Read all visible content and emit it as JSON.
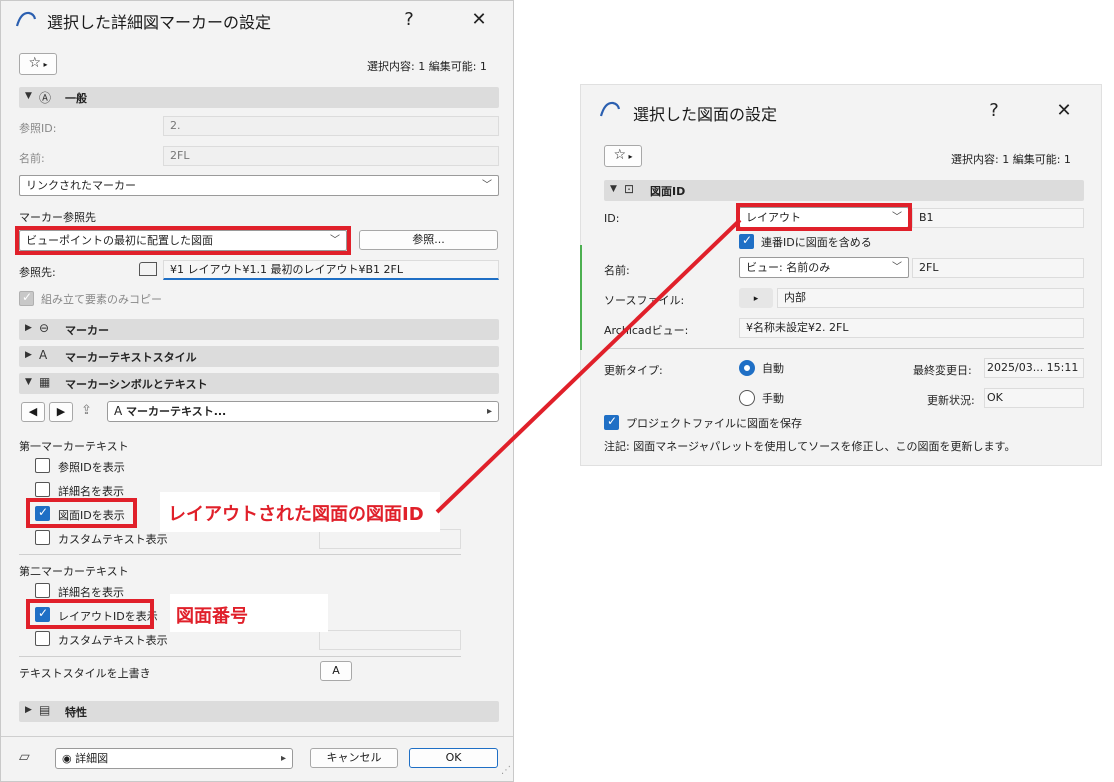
{
  "left": {
    "title": "選択した詳細図マーカーの設定",
    "help": "?",
    "close": "✕",
    "selection_status": "選択内容: 1 編集可能: 1",
    "general": {
      "section_label": "一般",
      "ref_id_label": "参照ID:",
      "ref_id_value": "2.",
      "name_label": "名前:",
      "name_value": "2FL",
      "linked_marker": "リンクされたマーカー",
      "marker_ref_label": "マーカー参照先",
      "marker_ref_value": "ビューポイントの最初に配置した図面",
      "browse_button": "参照...",
      "ref_to_label": "参照先:",
      "ref_to_value": "¥1 レイアウト¥1.1 最初のレイアウト¥B1 2FL",
      "assembly_only": "組み立て要素のみコピー"
    },
    "sections": {
      "marker": "マーカー",
      "marker_text_style": "マーカーテキストスタイル",
      "marker_symbol_text": "マーカーシンボルとテキスト",
      "properties": "特性"
    },
    "marker_text_dropdown": "マーカーテキスト...",
    "first_marker_text": {
      "heading": "第一マーカーテキスト",
      "items": [
        "参照IDを表示",
        "詳細名を表示",
        "図面IDを表示",
        "カスタムテキスト表示"
      ]
    },
    "second_marker_text": {
      "heading": "第二マーカーテキスト",
      "items": [
        "詳細名を表示",
        "レイアウトIDを表示",
        "カスタムテキスト表示"
      ]
    },
    "override_text_style": "テキストスタイルを上書き",
    "footer": {
      "view_select": "詳細図",
      "cancel": "キャンセル",
      "ok": "OK"
    }
  },
  "right": {
    "title": "選択した図面の設定",
    "help": "?",
    "close": "✕",
    "selection_status": "選択内容: 1 編集可能: 1",
    "section_label": "図面ID",
    "id_label": "ID:",
    "id_select": "レイアウト",
    "id_value": "B1",
    "include_serial": "連番IDに図面を含める",
    "name_label": "名前:",
    "name_select": "ビュー: 名前のみ",
    "name_value": "2FL",
    "source_file_label": "ソースファイル:",
    "source_file_value": "内部",
    "archicad_view_label": "Archicadビュー:",
    "archicad_view_value": "¥名称未設定¥2. 2FL",
    "update_type_label": "更新タイプ:",
    "auto": "自動",
    "manual": "手動",
    "last_modified_label": "最終変更日:",
    "last_modified_value": "2025/03... 15:11",
    "update_status_label": "更新状況:",
    "update_status_value": "OK",
    "save_in_project": "プロジェクトファイルに図面を保存",
    "note": "注記: 図面マネージャパレットを使用してソースを修正し、この図面を更新します。"
  },
  "annotations": {
    "drawing_id_note": "レイアウトされた図面の図面ID",
    "drawing_number_note": "図面番号"
  },
  "colors": {
    "accent": "#1f6fc5",
    "annotation": "#e0202a"
  }
}
